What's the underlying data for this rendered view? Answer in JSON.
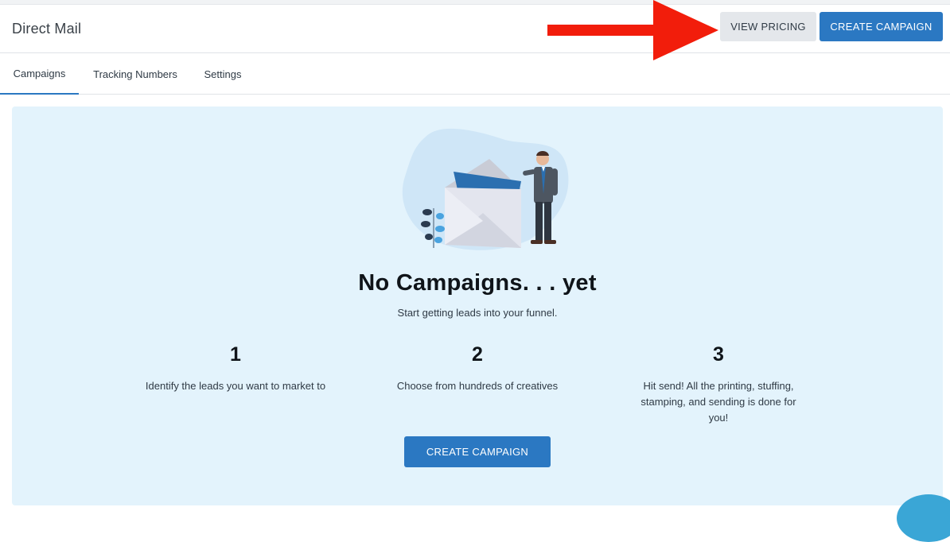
{
  "header": {
    "title": "Direct Mail",
    "view_pricing_label": "VIEW PRICING",
    "create_campaign_label": "CREATE CAMPAIGN"
  },
  "tabs": [
    {
      "label": "Campaigns",
      "active": true
    },
    {
      "label": "Tracking Numbers",
      "active": false
    },
    {
      "label": "Settings",
      "active": false
    }
  ],
  "empty_state": {
    "title": "No Campaigns. . . yet",
    "subtitle": "Start getting leads into your funnel.",
    "steps": [
      {
        "number": "1",
        "text": "Identify the leads you want to market to"
      },
      {
        "number": "2",
        "text": "Choose from hundreds of creatives"
      },
      {
        "number": "3",
        "text": "Hit send! All the printing, stuffing, stamping, and sending is done for you!"
      }
    ],
    "cta_label": "CREATE CAMPAIGN"
  },
  "icons": {
    "arrow": "red-arrow-right-icon",
    "illustration": "envelope-businessman-illustration",
    "chat": "chat-bubble-icon"
  },
  "colors": {
    "primary": "#2b78c2",
    "panel_bg": "#e3f3fc",
    "annotation_arrow": "#f21d0b"
  }
}
